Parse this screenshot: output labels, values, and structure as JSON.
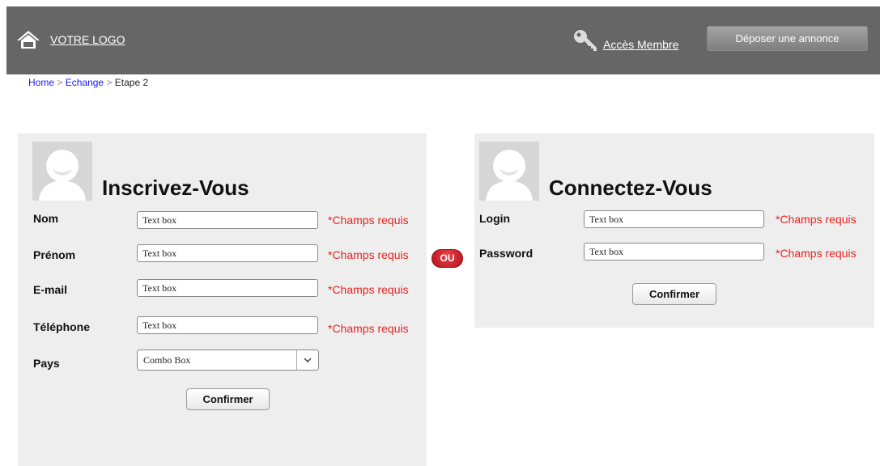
{
  "header": {
    "logo_label": "VOTRE LOGO",
    "member_label": "Accès Membre",
    "post_ad_label": "Déposer une annonce",
    "home_icon": "home-icon",
    "key_icon": "key-icon"
  },
  "breadcrumb": {
    "items": [
      "Home",
      "Echange"
    ],
    "separator": ">",
    "current": "Etape 2"
  },
  "register": {
    "title": "Inscrivez-Vous",
    "fields": [
      {
        "label": "Nom",
        "value": "Text box",
        "required": "*Champs requis"
      },
      {
        "label": "Prénom",
        "value": "Text box",
        "required": "*Champs requis"
      },
      {
        "label": "E-mail",
        "value": "Text box",
        "required": "*Champs requis"
      },
      {
        "label": "Téléphone",
        "value": "Text box",
        "required": "*Champs requis"
      }
    ],
    "country": {
      "label": "Pays",
      "value": "Combo Box"
    },
    "confirm_label": "Confirmer"
  },
  "separator_label": "OU",
  "login": {
    "title": "Connectez-Vous",
    "fields": [
      {
        "label": "Login",
        "value": "Text box",
        "required": "*Champs requis"
      },
      {
        "label": "Password",
        "value": "Text box",
        "required": "*Champs requis"
      }
    ],
    "confirm_label": "Confirmer"
  },
  "colors": {
    "header_bg": "#666666",
    "panel_bg": "#eeeeee",
    "required_text": "#e8231f",
    "link_blue": "#1a1aee",
    "badge_red": "#c8161f"
  }
}
